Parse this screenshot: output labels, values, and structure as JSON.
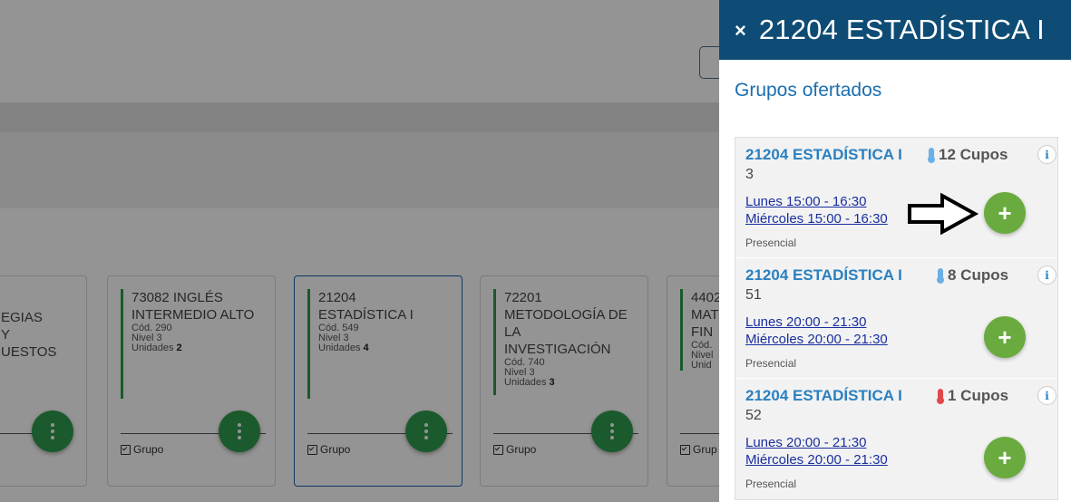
{
  "panel": {
    "close_icon": "×",
    "title": "21204 ESTADÍSTICA I",
    "section_title": "Grupos ofertados",
    "offers": [
      {
        "course": "21204 ESTADÍSTICA I",
        "group": "3",
        "cupos": "12 Cupos",
        "thermo": "blue",
        "schedule": [
          "Lunes 15:00 - 16:30",
          "Miércoles 15:00 - 16:30"
        ],
        "modality": "Presencial"
      },
      {
        "course": "21204 ESTADÍSTICA I",
        "group": "51",
        "cupos": "8 Cupos",
        "thermo": "blue",
        "schedule": [
          "Lunes 20:00 - 21:30",
          "Miércoles 20:00 - 21:30"
        ],
        "modality": "Presencial"
      },
      {
        "course": "21204 ESTADÍSTICA I",
        "group": "52",
        "cupos": "1 Cupos",
        "thermo": "red",
        "schedule": [
          "Lunes 20:00 - 21:30",
          "Miércoles 20:00 - 21:30"
        ],
        "modality": "Presencial"
      }
    ],
    "info_icon": "i",
    "add_icon": "+"
  },
  "background": {
    "cards": [
      {
        "title": "EGIAS Y UESTOS",
        "lines": [
          "EGIAS",
          "Y",
          "UESTOS"
        ],
        "cod": "",
        "nivel": "",
        "unidades": ""
      },
      {
        "title": "73082 INGLÉS INTERMEDIO ALTO",
        "lines": [
          "73082 INGLÉS",
          "INTERMEDIO ALTO"
        ],
        "cod": "Cód. 290",
        "nivel": "Nivel 3",
        "unidades_label": "Unidades",
        "unidades": "2",
        "grupo": "Grupo"
      },
      {
        "title": "21204 ESTADÍSTICA I",
        "lines": [
          "21204",
          "ESTADÍSTICA I"
        ],
        "cod": "Cód. 549",
        "nivel": "Nivel 3",
        "unidades_label": "Unidades",
        "unidades": "4",
        "grupo": "Grupo"
      },
      {
        "title": "72201 METODOLOGÍA DE LA INVESTIGACIÓN",
        "lines": [
          "72201",
          "METODOLOGÍA DE",
          "LA",
          "INVESTIGACIÓN"
        ],
        "cod": "Cód. 740",
        "nivel": "Nivel 3",
        "unidades_label": "Unidades",
        "unidades": "3",
        "grupo": "Grupo"
      },
      {
        "title": "4402 MAT FIN",
        "lines": [
          "4402",
          "MAT",
          "FIN"
        ],
        "cod": "Cód.",
        "nivel": "Nivel",
        "unidades_label": "Unid",
        "unidades": "",
        "grupo": "Grup"
      }
    ]
  },
  "colors": {
    "header": "#0e4c75",
    "accent_blue": "#2a80c0",
    "add_green": "#6aab3f",
    "card_green": "#2e9a4a"
  }
}
